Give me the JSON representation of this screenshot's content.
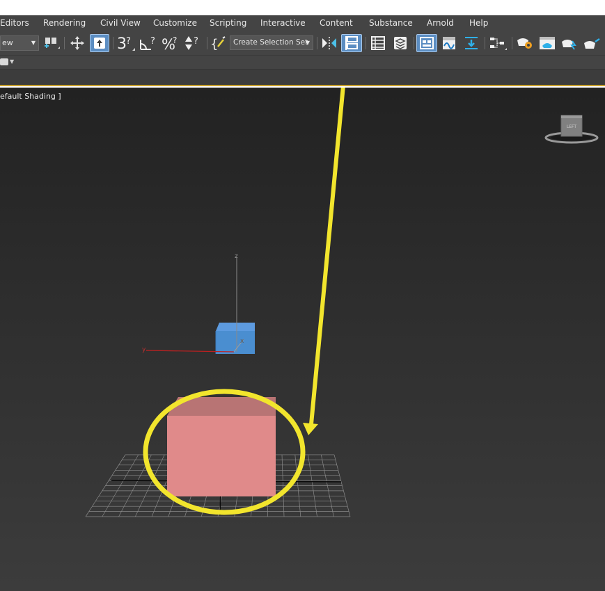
{
  "menu": {
    "items": [
      "Editors",
      "Rendering",
      "Civil View",
      "Customize",
      "Scripting",
      "Interactive",
      "Content",
      "Substance",
      "Arnold",
      "Help"
    ]
  },
  "toolbar": {
    "view_dropdown": "ew",
    "selection_set_placeholder": "Create Selection Set",
    "icons": [
      "select-and-link-icon",
      "move-icon",
      "select-object-icon",
      "snap-3d-icon",
      "angle-snap-icon",
      "percent-snap-icon",
      "spinner-snap-icon",
      "edit-named-selections-icon",
      "mirror-icon",
      "align-icon",
      "scene-explorer-icon",
      "layer-explorer-icon",
      "toggle-ribbon-icon",
      "curve-editor-icon",
      "dope-sheet-icon",
      "schematic-view-icon",
      "material-editor-icon",
      "render-setup-icon",
      "rendered-frame-icon",
      "render-production-icon"
    ],
    "active_icons": [
      "select-object-icon",
      "align-icon",
      "toggle-ribbon-icon"
    ]
  },
  "viewport": {
    "shading_label": "efault Shading ]",
    "view_cube_label": "LEFT",
    "axis_labels": {
      "z": "z",
      "y": "y",
      "x": "x"
    }
  },
  "colors": {
    "annotation": "#f2e52d",
    "small_box": "#4a8ed0",
    "large_box": "#e08a8a",
    "accent_line": "#c8a02a",
    "active_button": "#5b8dc2"
  }
}
